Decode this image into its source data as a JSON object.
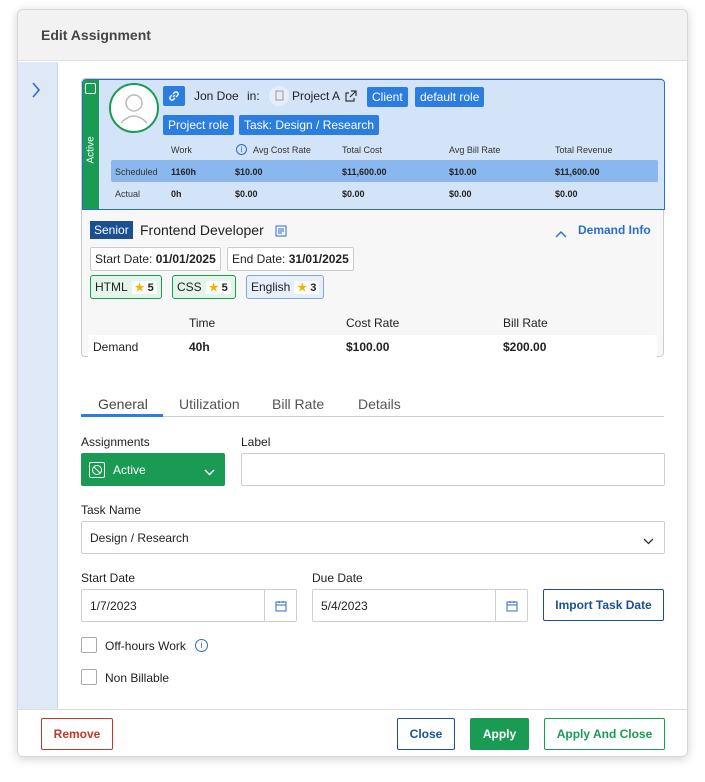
{
  "modal": {
    "title": "Edit Assignment"
  },
  "resource": {
    "status": "Active",
    "name": "Jon Doe",
    "in_label": "in:",
    "project": "Project A",
    "chips": [
      "Client",
      "default role",
      "Project role",
      "Task: Design / Research"
    ]
  },
  "metrics": {
    "headers": [
      "Work",
      "Avg Cost Rate",
      "Total Cost",
      "Avg Bill Rate",
      "Total Revenue"
    ],
    "rows": [
      {
        "label": "Scheduled",
        "values": [
          "1160h",
          "$10.00",
          "$11,600.00",
          "$10.00",
          "$11,600.00"
        ]
      },
      {
        "label": "Actual",
        "values": [
          "0h",
          "$0.00",
          "$0.00",
          "$0.00",
          "$0.00"
        ]
      }
    ]
  },
  "demand": {
    "seniority": "Senior",
    "role": "Frontend Developer",
    "toggle_label": "Demand Info",
    "start_label": "Start Date:",
    "start_value": "01/01/2025",
    "end_label": "End Date:",
    "end_value": "31/01/2025",
    "skills": [
      {
        "name": "HTML",
        "level": "5"
      },
      {
        "name": "CSS",
        "level": "5"
      },
      {
        "name": "English",
        "level": "3"
      }
    ],
    "table_headers": [
      "Time",
      "Cost Rate",
      "Bill Rate"
    ],
    "row_label": "Demand",
    "row_values": [
      "40h",
      "$100.00",
      "$200.00"
    ]
  },
  "tabs": [
    "General",
    "Utilization",
    "Bill Rate",
    "Details"
  ],
  "form": {
    "assignments_label": "Assignments",
    "assignments_value": "Active",
    "label_label": "Label",
    "label_value": "",
    "task_name_label": "Task Name",
    "task_name_value": "Design / Research",
    "start_date_label": "Start Date",
    "start_date_value": "1/7/2023",
    "due_date_label": "Due Date",
    "due_date_value": "5/4/2023",
    "import_button": "Import Task Date",
    "off_hours_label": "Off-hours Work",
    "non_billable_label": "Non Billable"
  },
  "footer": {
    "remove": "Remove",
    "close": "Close",
    "apply": "Apply",
    "apply_close": "Apply And Close"
  },
  "colors": {
    "primary": "#2b7de0",
    "success": "#1a9b53",
    "danger": "#c0392b",
    "accent_blue": "#2b6dcb"
  },
  "icons": [
    "chevron-right-icon",
    "link-icon",
    "external-link-icon",
    "document-icon",
    "info-icon",
    "chevron-up-icon",
    "star-icon",
    "calendar-icon",
    "chevron-down-icon",
    "status-clock-icon"
  ]
}
